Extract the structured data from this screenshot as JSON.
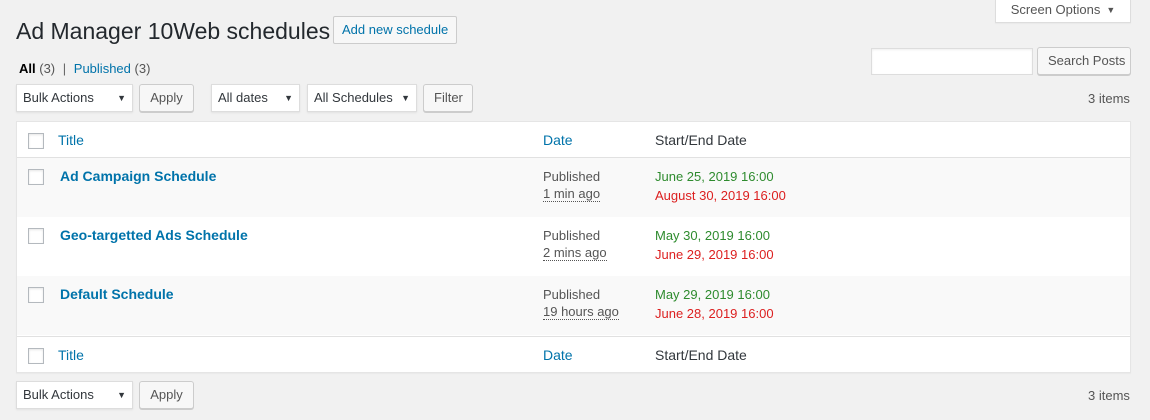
{
  "screen_options": {
    "label": "Screen Options"
  },
  "header": {
    "title": "Ad Manager 10Web schedules",
    "add_new_label": "Add new schedule"
  },
  "views": {
    "all_label": "All",
    "all_count": "(3)",
    "separator": "|",
    "published_label": "Published",
    "published_count": "(3)"
  },
  "search": {
    "button_label": "Search Posts",
    "value": ""
  },
  "tablenav_top": {
    "bulk_actions": "Bulk Actions",
    "apply_label": "Apply",
    "dates_filter": "All dates",
    "schedules_filter": "All Schedules",
    "filter_label": "Filter",
    "items_count": "3 items"
  },
  "table": {
    "columns": {
      "title": "Title",
      "date": "Date",
      "start_end": "Start/End Date"
    },
    "rows": [
      {
        "title": "Ad Campaign Schedule",
        "status": "Published",
        "ago": "1 min ago",
        "start": "June 25, 2019 16:00",
        "end": "August 30, 2019 16:00"
      },
      {
        "title": "Geo-targetted Ads Schedule",
        "status": "Published",
        "ago": "2 mins ago",
        "start": "May 30, 2019 16:00",
        "end": "June 29, 2019 16:00"
      },
      {
        "title": "Default Schedule",
        "status": "Published",
        "ago": "19 hours ago",
        "start": "May 29, 2019 16:00",
        "end": "June 28, 2019 16:00"
      }
    ]
  },
  "tablenav_bottom": {
    "bulk_actions": "Bulk Actions",
    "apply_label": "Apply",
    "items_count": "3 items"
  },
  "colors": {
    "link": "#0073aa",
    "start_date": "#2e8b2e",
    "end_date": "#dc1f1f",
    "background": "#f1f1f1"
  },
  "icons": {
    "dropdown": "caret-down-icon"
  }
}
